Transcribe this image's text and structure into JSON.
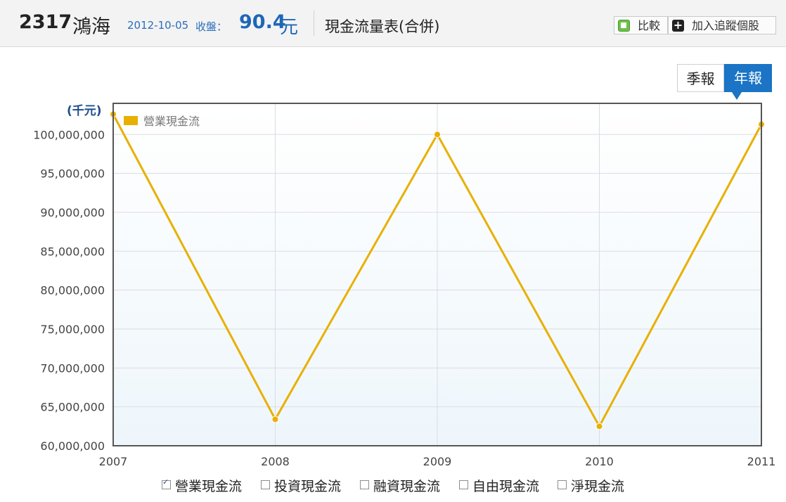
{
  "header": {
    "stock_code": "2317",
    "stock_name": "鴻海",
    "date": "2012-10-05",
    "close_label": "收盤：",
    "price": "90.4",
    "price_unit": "元",
    "report_title": "現金流量表(合併)",
    "compare_label": "比較",
    "track_label": "加入追蹤個股"
  },
  "period_tabs": {
    "quarterly": "季報",
    "annual": "年報",
    "selected": "annual"
  },
  "chart_data": {
    "type": "line",
    "unit_label": "(千元)",
    "x": [
      "2007",
      "2008",
      "2009",
      "2010",
      "2011"
    ],
    "ylim": [
      60000000,
      104000000
    ],
    "yticks": [
      60000000,
      65000000,
      70000000,
      75000000,
      80000000,
      85000000,
      90000000,
      95000000,
      100000000
    ],
    "ytick_labels": [
      "60,000,000",
      "65,000,000",
      "70,000,000",
      "75,000,000",
      "80,000,000",
      "85,000,000",
      "90,000,000",
      "95,000,000",
      "100,000,000"
    ],
    "grid": true,
    "legend_position": "top-left",
    "series": [
      {
        "name": "營業現金流",
        "color": "#e8b000",
        "values": [
          102600000,
          63400000,
          100000000,
          62500000,
          101300000
        ]
      }
    ]
  },
  "series_toggles": [
    {
      "label": "營業現金流",
      "checked": true
    },
    {
      "label": "投資現金流",
      "checked": false
    },
    {
      "label": "融資現金流",
      "checked": false
    },
    {
      "label": "自由現金流",
      "checked": false
    },
    {
      "label": "淨現金流",
      "checked": false
    }
  ]
}
